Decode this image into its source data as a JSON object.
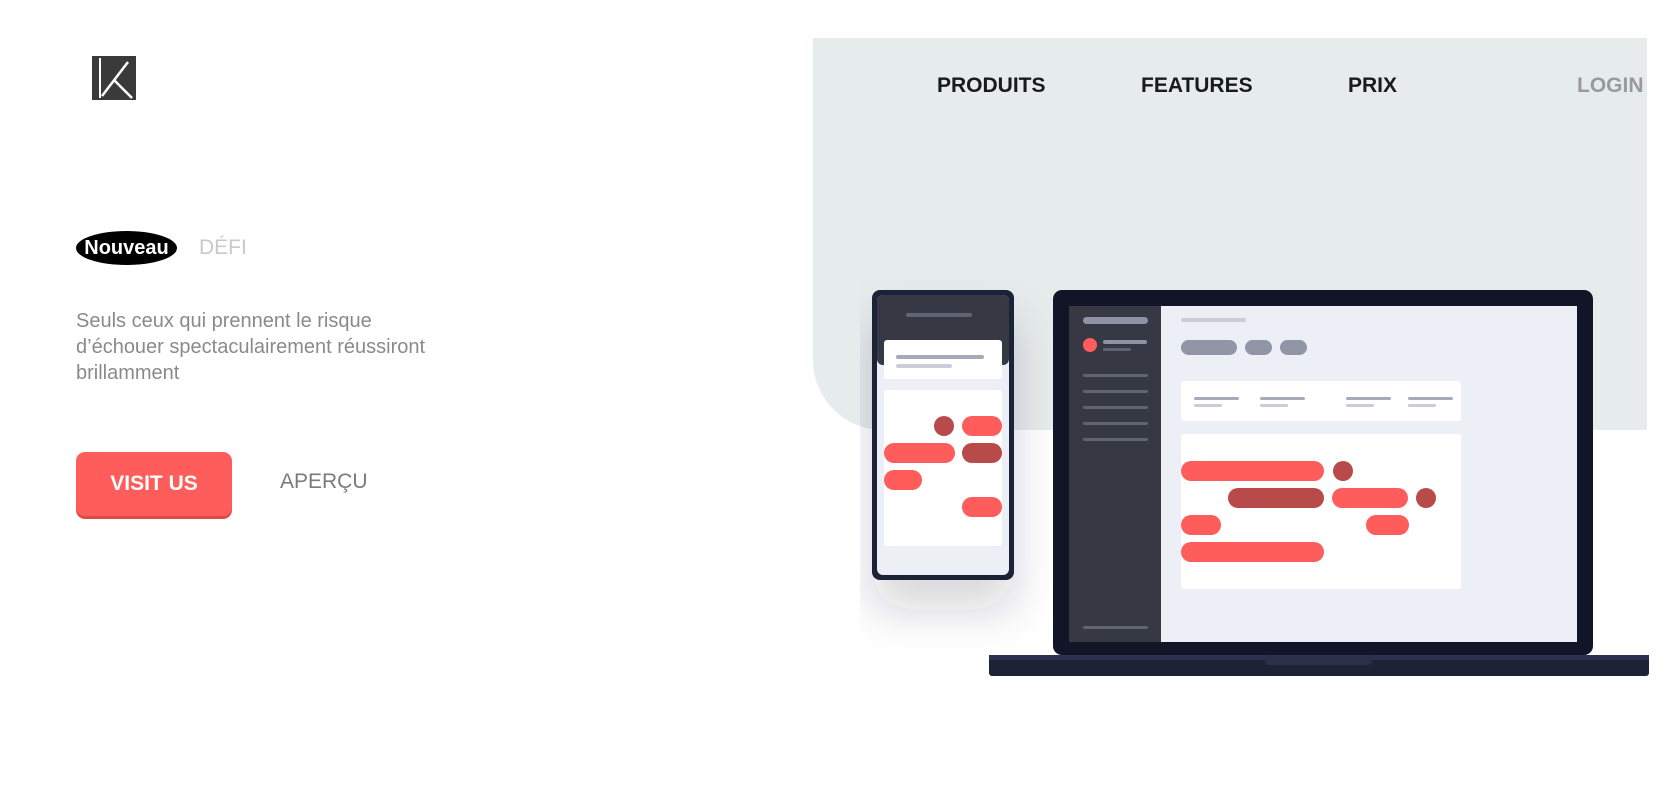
{
  "header": {
    "logo_icon": "k-logo-icon",
    "nav": {
      "produits": "PRODUITS",
      "features": "FEATURES",
      "prix": "PRIX",
      "login": "LOGIN"
    }
  },
  "hero": {
    "badge": "Nouveau",
    "badge_label": "DÉFI",
    "tagline": "Seuls ceux qui prennent le risque d’échouer spectaculairement réussiront brillamment",
    "cta_primary": "VISIT US",
    "cta_secondary": "APERÇU"
  },
  "colors": {
    "accent": "#ff5c5c",
    "accent_dark": "#b94a4a",
    "hero_background": "#e6ebeb",
    "device_dark": "#1e2237"
  },
  "illustration": {
    "name": "devices-illustration"
  }
}
